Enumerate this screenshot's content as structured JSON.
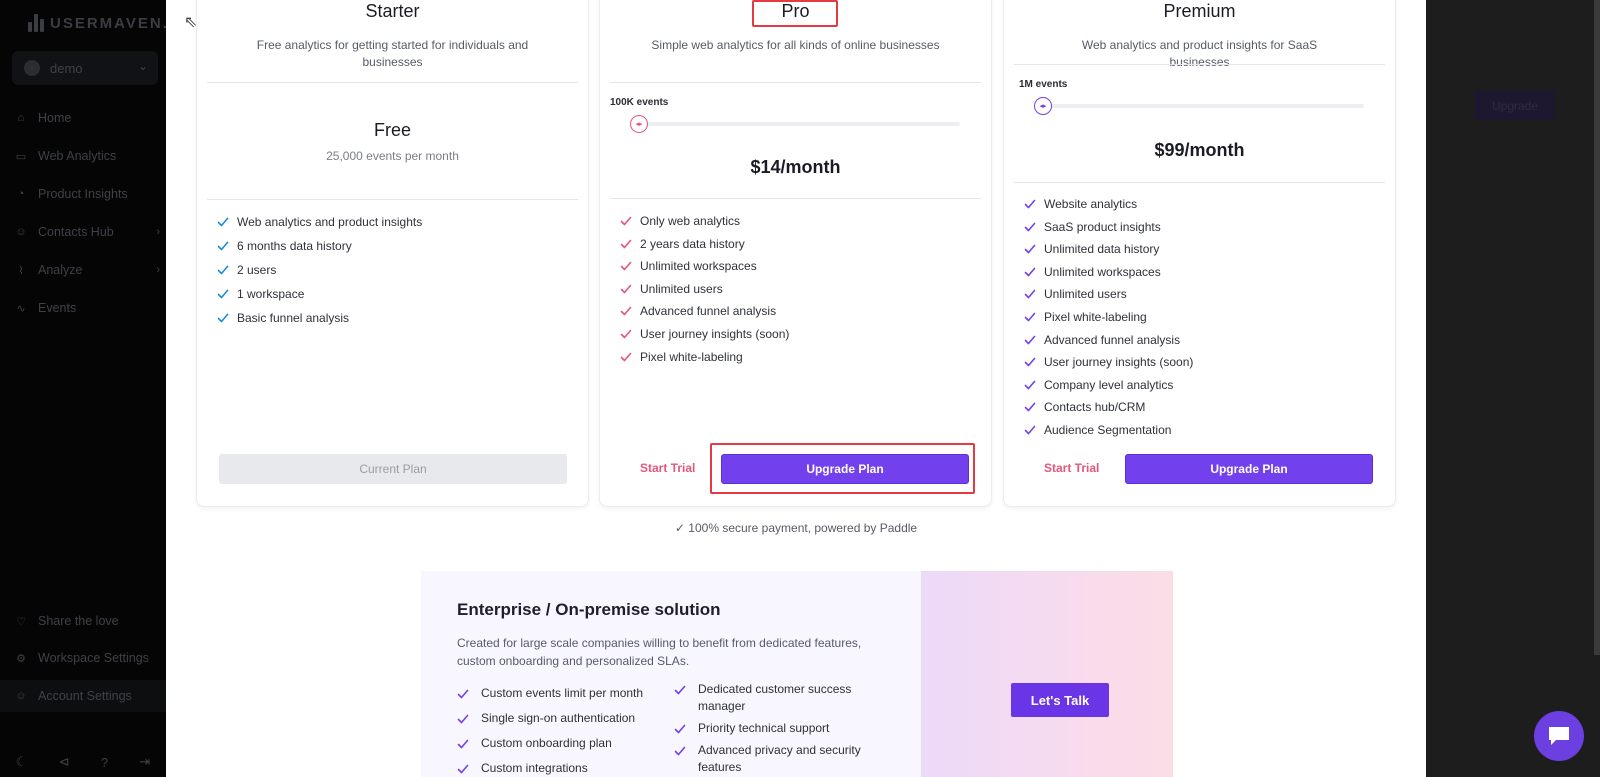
{
  "app": {
    "logo_text": "USERMAVEN.",
    "workspace": "demo"
  },
  "sidebar": {
    "items": [
      {
        "label": "Home",
        "icon": "home-icon"
      },
      {
        "label": "Web Analytics",
        "icon": "browser-icon"
      },
      {
        "label": "Product Insights",
        "icon": "pie-chart-icon"
      },
      {
        "label": "Contacts Hub",
        "icon": "user-icon"
      },
      {
        "label": "Analyze",
        "icon": "line-chart-icon"
      },
      {
        "label": "Events",
        "icon": "pulse-icon"
      }
    ],
    "bottom_items": [
      {
        "label": "Share the love",
        "icon": "heart-icon"
      },
      {
        "label": "Workspace Settings",
        "icon": "gear-icon"
      },
      {
        "label": "Account Settings",
        "icon": "user-gear-icon"
      }
    ]
  },
  "background": {
    "upgrade_label": "Upgrade"
  },
  "plans": {
    "starter": {
      "name": "Starter",
      "description": "Free analytics for getting started for individuals and businesses",
      "price": "Free",
      "events_note": "25,000 events per month",
      "features": [
        "Web analytics and product insights",
        "6 months data history",
        "2 users",
        "1 workspace",
        "Basic funnel analysis"
      ],
      "button_label": "Current Plan",
      "check_color": "#1a8fd8"
    },
    "pro": {
      "name": "Pro",
      "description": "Simple web analytics for all kinds of online businesses",
      "events_label": "100K events",
      "slider_position": 0,
      "price": "$14/month",
      "features": [
        "Only web analytics",
        "2 years data history",
        "Unlimited workspaces",
        "Unlimited users",
        "Advanced funnel analysis",
        "User journey insights (soon)",
        "Pixel white-labeling"
      ],
      "trial_label": "Start Trial",
      "button_label": "Upgrade Plan",
      "check_color": "#e3577a"
    },
    "premium": {
      "name": "Premium",
      "description": "Web analytics and product insights for SaaS businesses",
      "events_label": "1M events",
      "slider_position": 0,
      "price": "$99/month",
      "features": [
        "Website analytics",
        "SaaS product insights",
        "Unlimited data history",
        "Unlimited workspaces",
        "Unlimited users",
        "Pixel white-labeling",
        "Advanced funnel analysis",
        "User journey insights (soon)",
        "Company level analytics",
        "Contacts hub/CRM",
        "Audience Segmentation"
      ],
      "trial_label": "Start Trial",
      "button_label": "Upgrade Plan",
      "check_color": "#7340ee"
    }
  },
  "secure_note": "100% secure payment, powered by Paddle",
  "enterprise": {
    "title": "Enterprise / On-premise solution",
    "description": "Created for large scale companies willing to benefit from dedicated features, custom onboarding and personalized SLAs.",
    "features_left": [
      "Custom events limit per month",
      "Single sign-on authentication",
      "Custom onboarding plan",
      "Custom integrations"
    ],
    "features_right": [
      "Dedicated customer success manager",
      "Priority technical support",
      "Advanced privacy and security features"
    ],
    "button_label": "Let's Talk"
  },
  "colors": {
    "accent": "#7340ee",
    "highlight_box": "#e53943"
  }
}
